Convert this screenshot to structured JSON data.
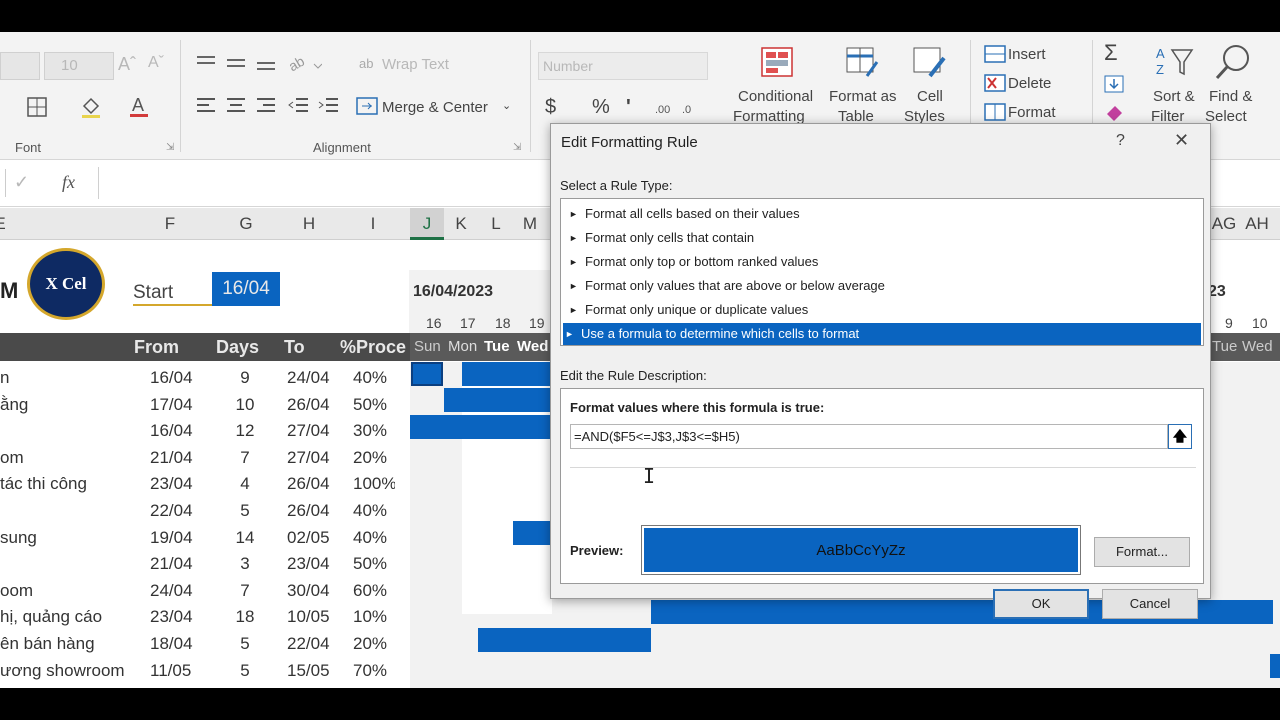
{
  "ribbon": {
    "font_size": "10",
    "font_group_label": "Font",
    "wrap_text": "Wrap Text",
    "merge_center": "Merge & Center",
    "alignment_group_label": "Alignment",
    "number_format": "Number",
    "currency_symbol": "$",
    "percent_symbol": "%",
    "comma_symbol": "'",
    "conditional_formatting": [
      "Conditional",
      "Formatting"
    ],
    "format_as_table": [
      "Format as",
      "Table"
    ],
    "cell_styles": [
      "Cell",
      "Styles"
    ],
    "insert": "Insert",
    "delete": "Delete",
    "format": "Format",
    "sort_filter": [
      "Sort &",
      "Filter"
    ],
    "find_select": [
      "Find &",
      "Select"
    ]
  },
  "formula_bar": {
    "check_symbol": "✓",
    "fx_label": "fx"
  },
  "columns": [
    "E",
    "F",
    "G",
    "H",
    "I",
    "J",
    "K",
    "L",
    "M",
    "AG",
    "AH"
  ],
  "sheet": {
    "logo_text": "X Cel",
    "logo_left_letter": "M",
    "start_label": "Start",
    "start_value": "16/04",
    "gantt_date": "16/04/2023",
    "gantt_date_right": "23",
    "days_numbers": [
      "16",
      "17",
      "18",
      "19"
    ],
    "days_numbers_right": [
      "9",
      "10"
    ],
    "day_names": [
      "Sun",
      "Mon",
      "Tue",
      "Wed"
    ],
    "day_names_right": [
      "Tue",
      "Wed"
    ],
    "headers": {
      "from": "From",
      "days": "Days",
      "to": "To",
      "progress": "%Proce"
    },
    "rows": [
      {
        "task": "n",
        "from": "16/04",
        "days": "9",
        "to": "24/04",
        "pct": "40%"
      },
      {
        "task": "ằng",
        "from": "17/04",
        "days": "10",
        "to": "26/04",
        "pct": "50%"
      },
      {
        "task": "",
        "from": "16/04",
        "days": "12",
        "to": "27/04",
        "pct": "30%"
      },
      {
        "task": "om",
        "from": "21/04",
        "days": "7",
        "to": "27/04",
        "pct": "20%"
      },
      {
        "task": "tác thi công",
        "from": "23/04",
        "days": "4",
        "to": "26/04",
        "pct": "100%"
      },
      {
        "task": "",
        "from": "22/04",
        "days": "5",
        "to": "26/04",
        "pct": "40%"
      },
      {
        "task": "sung",
        "from": "19/04",
        "days": "14",
        "to": "02/05",
        "pct": "40%"
      },
      {
        "task": "",
        "from": "21/04",
        "days": "3",
        "to": "23/04",
        "pct": "50%"
      },
      {
        "task": "oom",
        "from": "24/04",
        "days": "7",
        "to": "30/04",
        "pct": "60%"
      },
      {
        "task": "hị, quảng cáo",
        "from": "23/04",
        "days": "18",
        "to": "10/05",
        "pct": "10%"
      },
      {
        "task": "ên bán hàng",
        "from": "18/04",
        "days": "5",
        "to": "22/04",
        "pct": "20%"
      },
      {
        "task": "ương showroom",
        "from": "11/05",
        "days": "5",
        "to": "15/05",
        "pct": "70%"
      }
    ]
  },
  "dialog": {
    "title": "Edit Formatting Rule",
    "help": "?",
    "close": "✕",
    "select_rule_type_label": "Select a Rule Type:",
    "rule_types": [
      "Format all cells based on their values",
      "Format only cells that contain",
      "Format only top or bottom ranked values",
      "Format only values that are above or below average",
      "Format only unique or duplicate values",
      "Use a formula to determine which cells to format"
    ],
    "selected_rule_index": 5,
    "edit_description_label": "Edit the Rule Description:",
    "formula_label": "Format values where this formula is true:",
    "formula_value": "=AND($F5<=J$3,J$3<=$H5)",
    "preview_label": "Preview:",
    "preview_text": "AaBbCcYyZz",
    "format_button": "Format...",
    "ok_button": "OK",
    "cancel_button": "Cancel"
  },
  "colors": {
    "accent_blue": "#0a64c0",
    "header_dark": "#4a4a4a",
    "logo_navy": "#0e2a63",
    "logo_gold": "#d4a72c"
  }
}
